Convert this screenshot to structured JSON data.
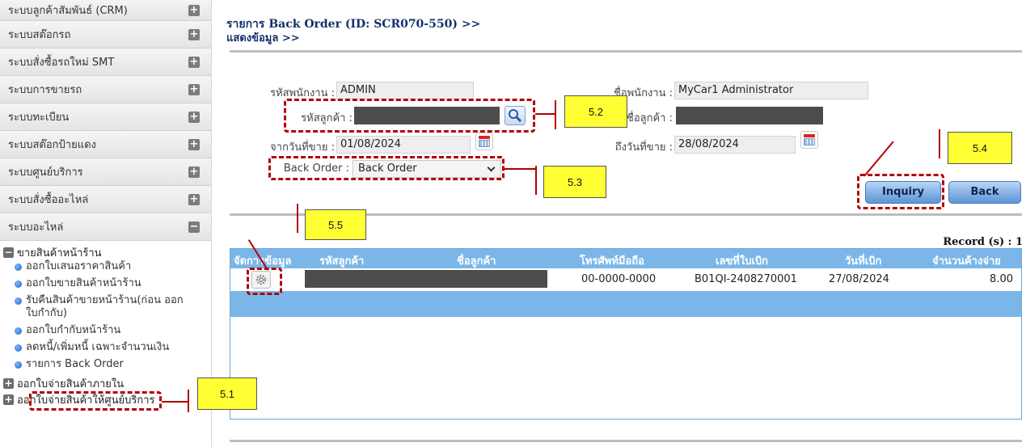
{
  "sidebar": {
    "menus": [
      {
        "label": "ระบบลูกค้าสัมพันธ์ (CRM)",
        "toggle": "+"
      },
      {
        "label": "ระบบสต๊อกรถ",
        "toggle": "+"
      },
      {
        "label": "ระบบสั่งซื้อรถใหม่ SMT",
        "toggle": "+"
      },
      {
        "label": "ระบบการขายรถ",
        "toggle": "+"
      },
      {
        "label": "ระบบทะเบียน",
        "toggle": "+"
      },
      {
        "label": "ระบบสต๊อกป้ายแดง",
        "toggle": "+"
      },
      {
        "label": "ระบบศูนย์บริการ",
        "toggle": "+"
      },
      {
        "label": "ระบบสั่งซื้ออะไหล่",
        "toggle": "+"
      },
      {
        "label": "ระบบอะไหล่",
        "toggle": "−"
      }
    ],
    "submenu_header": "ขายสินค้าหน้าร้าน",
    "submenu_items": [
      "ออกใบเสนอราคาสินค้า",
      "ออกใบขายสินค้าหน้าร้าน",
      "รับคืนสินค้าขายหน้าร้าน(ก่อน ออกใบกำกับ)",
      "ออกใบกำกับหน้าร้าน",
      "ลดหนี้/เพิ่มหนี้ เฉพาะจำนวนเงิน",
      "รายการ Back Order"
    ],
    "bottom_items": [
      "ออกใบจ่ายสินค้าภายใน",
      "ออกใบจ่ายสินค้าให้ศูนย์บริการ"
    ]
  },
  "page": {
    "title": "รายการ Back Order (ID: SCR070-550) >>",
    "subtitle": "แสดงข้อมูล >>"
  },
  "form": {
    "employee_code_label": "รหัสพนักงาน :",
    "employee_code": "ADMIN",
    "employee_name_label": "ชื่อพนักงาน :",
    "employee_name": "MyCar1 Administrator",
    "customer_code_label": "รหัสลูกค้า :",
    "customer_name_label": "ชื่อลูกค้า :",
    "date_from_label": "จากวันที่ขาย :",
    "date_from": "01/08/2024",
    "date_to_label": "ถึงวันที่ขาย :",
    "date_to": "28/08/2024",
    "back_order_label": "Back Order :",
    "back_order_value": "Back Order"
  },
  "buttons": {
    "inquiry": "Inquiry",
    "back": "Back"
  },
  "grid": {
    "record_text": "Record (s) : 1",
    "headers": [
      "จัดการข้อมูล",
      "รหัสลูกค้า",
      "ชื่อลูกค้า",
      "โทรศัพท์มือถือ",
      "เลขที่ใบเบิก",
      "วันที่เบิก",
      "จำนวนค้างจ่าย"
    ],
    "rows": [
      {
        "phone": "00-0000-0000",
        "doc_no": "B01QI-2408270001",
        "date": "27/08/2024",
        "qty": "8.00"
      }
    ]
  },
  "annotations": {
    "a51": "5.1",
    "a52": "5.2",
    "a53": "5.3",
    "a54": "5.4",
    "a55": "5.5"
  },
  "colors": {
    "title": "#14306b",
    "grid_header": "#7ab7e8",
    "callout": "#b20000",
    "tag": "#ffff33"
  }
}
